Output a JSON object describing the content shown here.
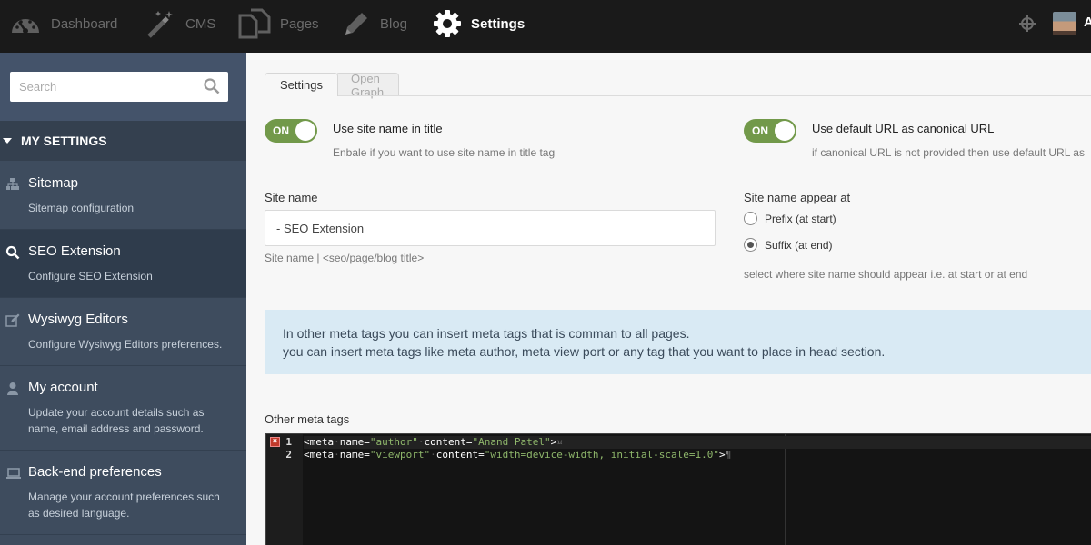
{
  "nav": {
    "items": [
      {
        "label": "Dashboard",
        "icon": "gauge-icon"
      },
      {
        "label": "CMS",
        "icon": "magic-wand-icon"
      },
      {
        "label": "Pages",
        "icon": "pages-icon"
      },
      {
        "label": "Blog",
        "icon": "pencil-icon"
      },
      {
        "label": "Settings",
        "icon": "gear-icon"
      }
    ],
    "active": "Settings",
    "user_initial": "A"
  },
  "sidebar": {
    "search_placeholder": "Search",
    "section_title": "MY SETTINGS",
    "items": [
      {
        "title": "Sitemap",
        "desc": "Sitemap configuration",
        "icon": "sitemap-icon"
      },
      {
        "title": "SEO Extension",
        "desc": "Configure SEO Extension",
        "icon": "search-icon"
      },
      {
        "title": "Wysiwyg Editors",
        "desc": "Configure Wysiwyg Editors preferences.",
        "icon": "edit-icon"
      },
      {
        "title": "My account",
        "desc": "Update your account details such as name, email address and password.",
        "icon": "user-icon"
      },
      {
        "title": "Back-end preferences",
        "desc": "Manage your account preferences such as desired language.",
        "icon": "laptop-icon"
      }
    ]
  },
  "tabs": [
    {
      "label": "Settings"
    },
    {
      "label": "Open Graph"
    }
  ],
  "form": {
    "site_name_toggle": {
      "state": "ON",
      "label": "Use site name in title",
      "hint": "Enbale if you want to use site name in title tag"
    },
    "canonical_toggle": {
      "state": "ON",
      "label": "Use default URL as canonical URL",
      "hint": "if canonical URL is not provided then use default URL as"
    },
    "site_name": {
      "label": "Site name",
      "value": "- SEO Extension",
      "hint": "Site name | <seo/page/blog title>"
    },
    "appear_at": {
      "label": "Site name appear at",
      "options": [
        "Prefix (at start)",
        "Suffix (at end)"
      ],
      "selected": "Suffix (at end)",
      "hint": "select where site name should appear i.e. at start or at end"
    },
    "info": {
      "line1": "In other meta tags you can insert meta tags that is comman to all pages.",
      "line2": "you can insert meta tags like meta author, meta view port or any tag that you want to place in head section."
    },
    "other_meta": {
      "label": "Other meta tags",
      "lines": [
        {
          "num": "1",
          "name": "author",
          "content": "Anand Patel",
          "error": true
        },
        {
          "num": "2",
          "name": "viewport",
          "content": "width=device-width, initial-scale=1.0",
          "error": false
        }
      ]
    }
  }
}
